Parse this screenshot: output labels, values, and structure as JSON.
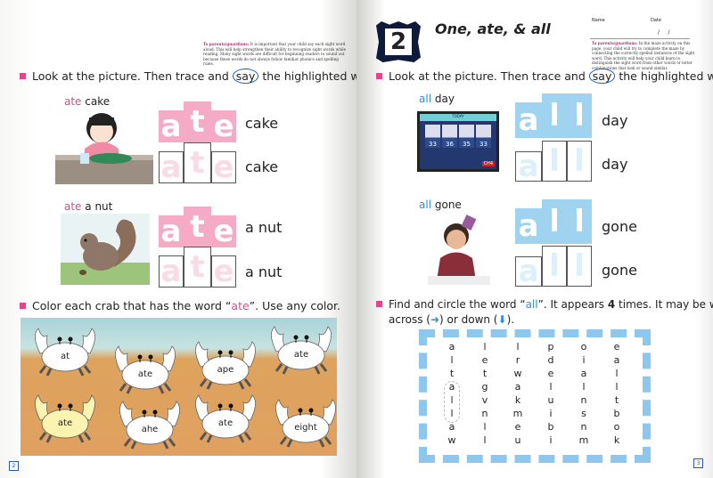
{
  "left_page": {
    "parent_note_label": "To parents/guardians:",
    "parent_note": " It is important that your child say each sight word aloud. This will help strengthen their ability to recognize sight words while reading. Many sight words are difficult for beginning readers to sound out because these words do not always follow familiar phonics and spelling rules.",
    "instruction_1a": "Look at the picture. Then trace and",
    "instruction_1say": "say",
    "instruction_1b": "the highlighted word.",
    "items": [
      {
        "highlight": "ate",
        "rest": "cake",
        "letters": [
          "a",
          "t",
          "e"
        ],
        "word": "cake"
      },
      {
        "highlight": "ate",
        "rest": "a nut",
        "letters": [
          "a",
          "t",
          "e"
        ],
        "word": "a nut"
      }
    ],
    "instruction_2a": "Color each crab that has the word “",
    "instruction_2word": "ate",
    "instruction_2b": "”. Use any color.",
    "crabs": [
      "at",
      "ate",
      "ape",
      "ate",
      "ate",
      "ahe",
      "ate",
      "eight"
    ],
    "page_number": "2"
  },
  "right_page": {
    "lesson_number": "2",
    "title": "One, ate, & all",
    "name_label": "Name",
    "date_label": "Date",
    "date_value": "/     /",
    "parent_note_label": "To parents/guardians:",
    "parent_note": " In the maze activity on this page, your child will try to complete the maze by connecting the correctly spelled instances of the sight word. This activity will help your child learn to distinguish the sight word from other words or letter combinations that look or sound similar.",
    "instruction_1a": "Look at the picture. Then trace and",
    "instruction_1say": "say",
    "instruction_1b": "the highlighted word.",
    "items": [
      {
        "highlight": "all",
        "rest": "day",
        "letters": [
          "a",
          "l",
          "l"
        ],
        "word": "day"
      },
      {
        "highlight": "all",
        "rest": "gone",
        "letters": [
          "a",
          "l",
          "l"
        ],
        "word": "gone"
      }
    ],
    "tv": {
      "header": "TODAY",
      "temps": [
        "33",
        "36",
        "35",
        "33"
      ],
      "channel": "CH4"
    },
    "instruction_2a": "Find and circle the word “",
    "instruction_2word": "all",
    "instruction_2b": "”. It appears",
    "instruction_2count": "4",
    "instruction_2c": "times. It may be written",
    "instruction_2d": "across (",
    "instruction_2e": ") or down (",
    "instruction_2f": ").",
    "grid": [
      [
        "a",
        "l",
        "l",
        "p",
        "o",
        "e"
      ],
      [
        "l",
        "e",
        "r",
        "d",
        "i",
        "a"
      ],
      [
        "t",
        "t",
        "w",
        "e",
        "a",
        "l"
      ],
      [
        "a",
        "g",
        "a",
        "l",
        "l",
        "l"
      ],
      [
        "l",
        "v",
        "k",
        "u",
        "n",
        "t"
      ],
      [
        "l",
        "n",
        "m",
        "i",
        "s",
        "b"
      ],
      [
        "a",
        "l",
        "e",
        "b",
        "n",
        "o"
      ],
      [
        "w",
        "l",
        "u",
        "i",
        "m",
        "k"
      ]
    ],
    "page_number": "3"
  },
  "colors": {
    "pink": "#e0468a",
    "blue": "#2a8fd6",
    "pink_fill": "#f5aac6",
    "blue_fill": "#9fd3f0",
    "border_blue": "#8ec7ee"
  }
}
